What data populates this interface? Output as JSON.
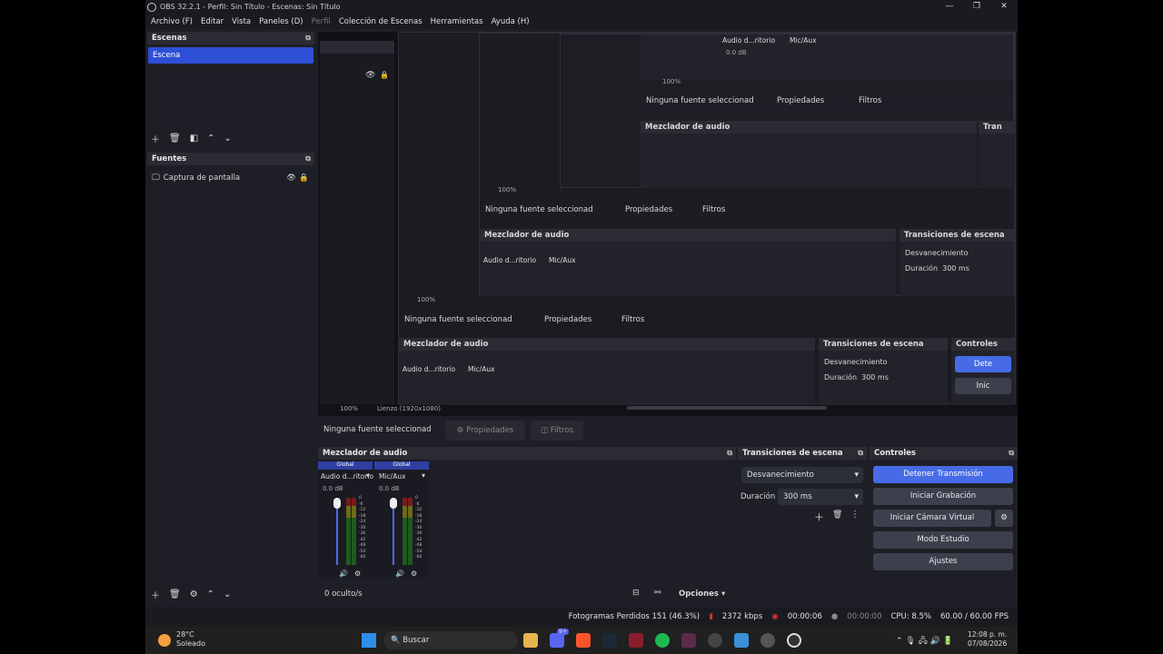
{
  "window": {
    "title": "OBS 32.2.1 - Perfil: Sin Título - Escenas: Sin Título"
  },
  "menu": [
    "Archivo (F)",
    "Editar",
    "Vista",
    "Paneles (D)",
    "Perfil",
    "Colección de Escenas",
    "Herramientas",
    "Ayuda (H)"
  ],
  "scenes": {
    "title": "Escenas",
    "items": [
      "Escena"
    ]
  },
  "sources": {
    "title": "Fuentes",
    "items": [
      "Captura de pantalla"
    ]
  },
  "source_bar": {
    "none_selected": "Ninguna fuente seleccionad",
    "properties": "Propiedades",
    "filters": "Filtros"
  },
  "mixer": {
    "title": "Mezclador de audio",
    "channels": [
      {
        "tag": "Global",
        "name": "Audio d...ritorio",
        "db": "0.0 dB"
      },
      {
        "tag": "Global",
        "name": "Mic/Aux",
        "db": "0.0 dB"
      }
    ],
    "scale": [
      "0",
      "-6",
      "-12",
      "-18",
      "-24",
      "-30",
      "-36",
      "-42",
      "-48",
      "-54",
      "-60"
    ],
    "hidden_count": "0 oculto/s",
    "options": "Opciones"
  },
  "transitions": {
    "title": "Transiciones de escena",
    "selected": "Desvanecimiento",
    "duration_label": "Duración",
    "duration_value": "300 ms",
    "short_title": "Tran",
    "short_selected": "Desv",
    "short_duration": "Durac"
  },
  "controls": {
    "title": "Controles",
    "stop_stream": "Detener Transmisión",
    "start_recording": "Iniciar Grabación",
    "start_virtualcam": "Iniciar Cámara Virtual",
    "studio_mode": "Modo Estudio",
    "settings": "Ajustes",
    "short_stop": "Dete",
    "short_start": "Inic"
  },
  "preview": {
    "zoom": "100%",
    "canvas": "Lienzo (1920x1080)"
  },
  "status": {
    "dropped": "Fotogramas Perdidos 151 (46.3%)",
    "kbps": "2372 kbps",
    "stream_time": "00:00:06",
    "rec_time": "00:00:00",
    "cpu": "CPU: 8.5%",
    "fps": "60.00 / 60.00 FPS"
  },
  "taskbar": {
    "temp": "28°C",
    "weather": "Soleado",
    "search": "Buscar",
    "time": "12:08 p. m.",
    "date": "07/08/2026",
    "badge": "9+"
  },
  "colors": {
    "accent": "#476be6",
    "selected": "#2d4fd6",
    "bg": "#1e1f26"
  }
}
